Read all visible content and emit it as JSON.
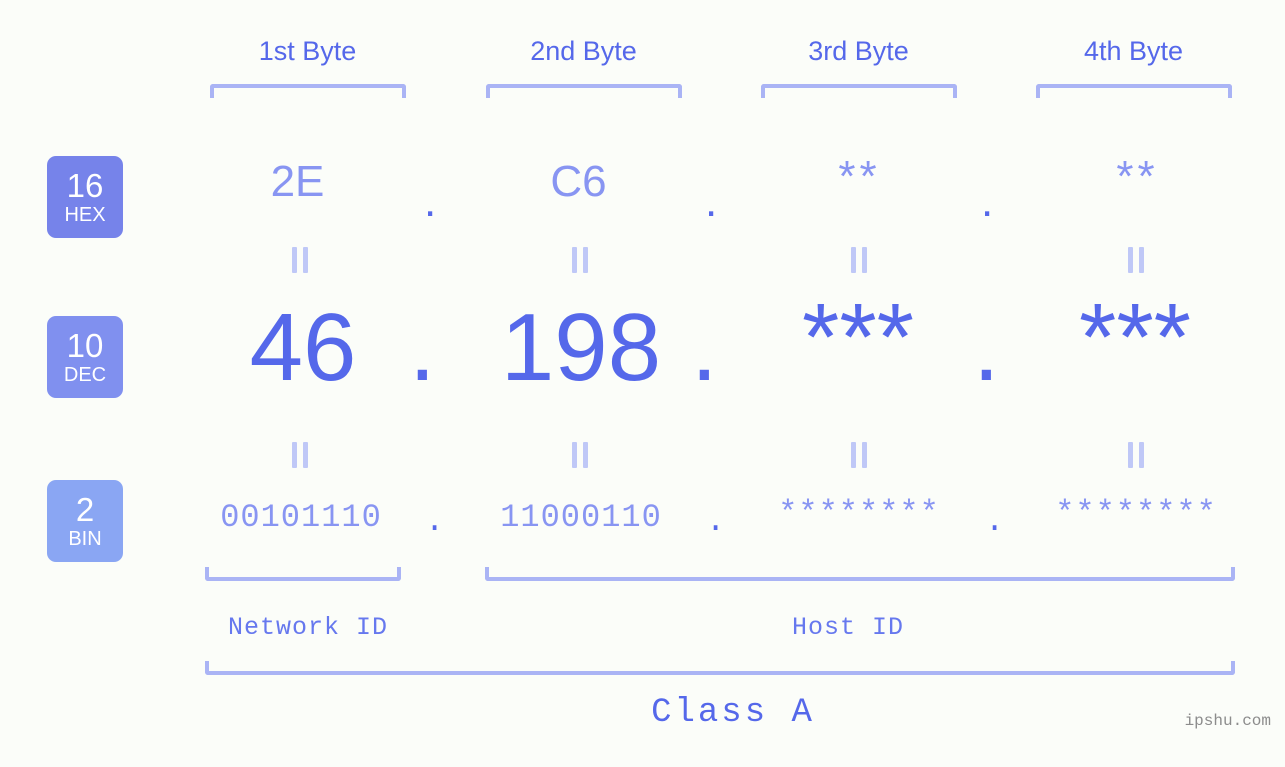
{
  "meta": {
    "watermark": "ipshu.com",
    "background_color": "#fbfdf9",
    "accent_color": "#5568ea",
    "accent_light_color": "#8895f2",
    "bracket_color": "#aab4f5"
  },
  "header": {
    "byte_labels": [
      {
        "label": "1st Byte"
      },
      {
        "label": "2nd Byte"
      },
      {
        "label": "3rd Byte"
      },
      {
        "label": "4th Byte"
      }
    ]
  },
  "rows": {
    "hex": {
      "badge_number": "16",
      "badge_abbr": "HEX",
      "badge_color": "#7683ea",
      "values": [
        "2E",
        "C6",
        "**",
        "**"
      ],
      "separator": "."
    },
    "dec": {
      "badge_number": "10",
      "badge_abbr": "DEC",
      "badge_color": "#8090ef",
      "values": [
        "46",
        "198",
        "***",
        "***"
      ],
      "separator": "."
    },
    "bin": {
      "badge_number": "2",
      "badge_abbr": "BIN",
      "badge_color": "#8aa6f3",
      "values": [
        "00101110",
        "11000110",
        "********",
        "********"
      ],
      "separator": "."
    }
  },
  "connectors": {
    "equals_symbol": "="
  },
  "footer": {
    "network_id_label": "Network ID",
    "host_id_label": "Host ID",
    "class_label": "Class A"
  }
}
